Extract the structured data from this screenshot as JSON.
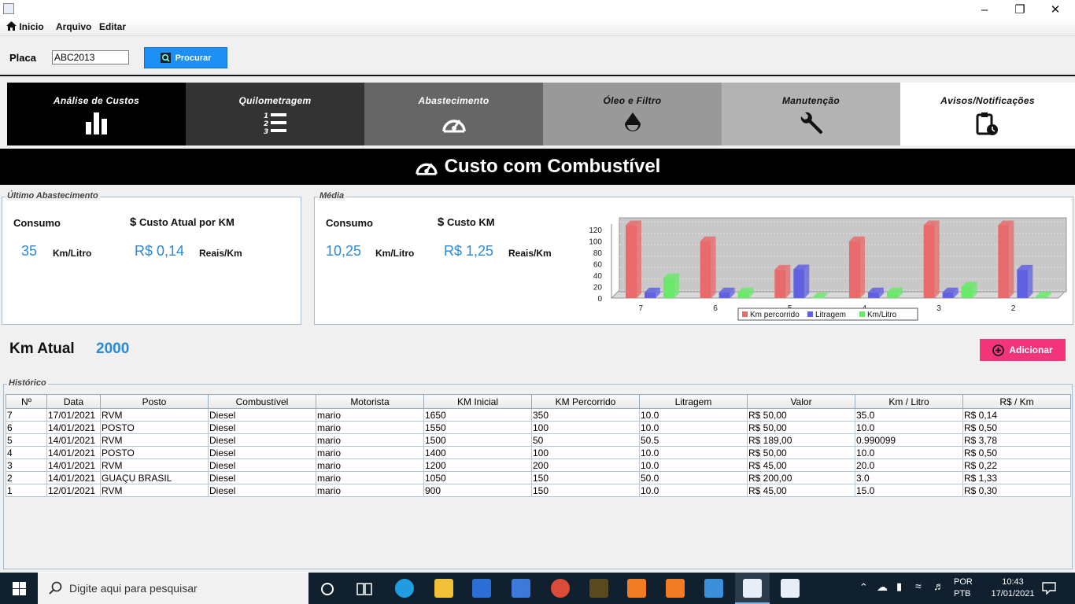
{
  "menu": {
    "home": "Inicio",
    "arquivo": "Arquivo",
    "editar": "Editar"
  },
  "search": {
    "label": "Placa",
    "value": "ABC2013",
    "button": "Procurar"
  },
  "tabs": [
    {
      "label": "Análise de Custos",
      "icon": "bar-chart-icon",
      "bg": "#000000",
      "fg": "#ffffff"
    },
    {
      "label": "Quilometragem",
      "icon": "numbered-list-icon",
      "bg": "#333333",
      "fg": "#ffffff"
    },
    {
      "label": "Abastecimento",
      "icon": "speedometer-icon",
      "bg": "#666666",
      "fg": "#ffffff"
    },
    {
      "label": "Óleo e Filtro",
      "icon": "oil-drop-icon",
      "bg": "#999999",
      "fg": "#111111"
    },
    {
      "label": "Manutenção",
      "icon": "wrench-icon",
      "bg": "#b3b3b3",
      "fg": "#111111"
    },
    {
      "label": "Avisos/Notificações",
      "icon": "clipboard-clock-icon",
      "bg": "#ffffff",
      "fg": "#111111"
    }
  ],
  "banner": {
    "title": "Custo com Combustível"
  },
  "ultimo": {
    "title": "Último Abastecimento",
    "consumo_label": "Consumo",
    "custo_label": "Custo Atual por KM",
    "consumo_value": "35",
    "consumo_unit": "Km/Litro",
    "custo_value": "R$ 0,14",
    "custo_unit": "Reais/Km"
  },
  "media": {
    "title": "Média",
    "consumo_label": "Consumo",
    "custo_label": "Custo KM",
    "consumo_value": "10,25",
    "consumo_unit": "Km/Litro",
    "custo_value": "R$ 1,25",
    "custo_unit": "Reais/Km"
  },
  "chart_data": {
    "type": "bar",
    "categories": [
      "7",
      "6",
      "5",
      "4",
      "3",
      "2"
    ],
    "series": [
      {
        "name": "Km percorrido",
        "color": "#e86a6a",
        "values": [
          128,
          100,
          50,
          100,
          128,
          128
        ]
      },
      {
        "name": "Litragem",
        "color": "#6060e0",
        "values": [
          10,
          10,
          50.5,
          10,
          10,
          50
        ]
      },
      {
        "name": "Km/Litro",
        "color": "#6ae86a",
        "values": [
          35,
          10,
          0.99,
          10,
          20,
          3
        ]
      }
    ],
    "yticks": [
      0,
      20,
      40,
      60,
      80,
      100,
      120
    ],
    "ylim": [
      0,
      130
    ],
    "legend": "bottom"
  },
  "km_atual": {
    "label": "Km Atual",
    "value": "2000"
  },
  "add_button": "Adicionar",
  "historico": {
    "title": "Histórico",
    "columns": [
      "Nº",
      "Data",
      "Posto",
      "Combustível",
      "Motorista",
      "KM Inicial",
      "KM Percorrido",
      "Litragem",
      "Valor",
      "Km / Litro",
      "R$ / Km"
    ],
    "rows": [
      [
        "7",
        "17/01/2021",
        "RVM",
        "Diesel",
        "mario",
        "1650",
        "350",
        "10.0",
        "R$ 50,00",
        "35.0",
        "R$ 0,14"
      ],
      [
        "6",
        "14/01/2021",
        "POSTO",
        "Diesel",
        "mario",
        "1550",
        "100",
        "10.0",
        "R$ 50,00",
        "10.0",
        "R$ 0,50"
      ],
      [
        "5",
        "14/01/2021",
        "RVM",
        "Diesel",
        "mario",
        "1500",
        "50",
        "50.5",
        "R$ 189,00",
        "0.990099",
        "R$ 3,78"
      ],
      [
        "4",
        "14/01/2021",
        "POSTO",
        "Diesel",
        "mario",
        "1400",
        "100",
        "10.0",
        "R$ 50,00",
        "10.0",
        "R$ 0,50"
      ],
      [
        "3",
        "14/01/2021",
        "RVM",
        "Diesel",
        "mario",
        "1200",
        "200",
        "10.0",
        "R$ 45,00",
        "20.0",
        "R$ 0,22"
      ],
      [
        "2",
        "14/01/2021",
        "GUAÇU BRASIL",
        "Diesel",
        "mario",
        "1050",
        "150",
        "50.0",
        "R$ 200,00",
        "3.0",
        "R$ 1,33"
      ],
      [
        "1",
        "12/01/2021",
        "RVM",
        "Diesel",
        "mario",
        "900",
        "150",
        "10.0",
        "R$ 45,00",
        "15.0",
        "R$ 0,30"
      ]
    ]
  },
  "taskbar": {
    "search_placeholder": "Digite aqui para pesquisar",
    "lang1": "POR",
    "lang2": "PTB",
    "time": "10:43",
    "date": "17/01/2021"
  }
}
